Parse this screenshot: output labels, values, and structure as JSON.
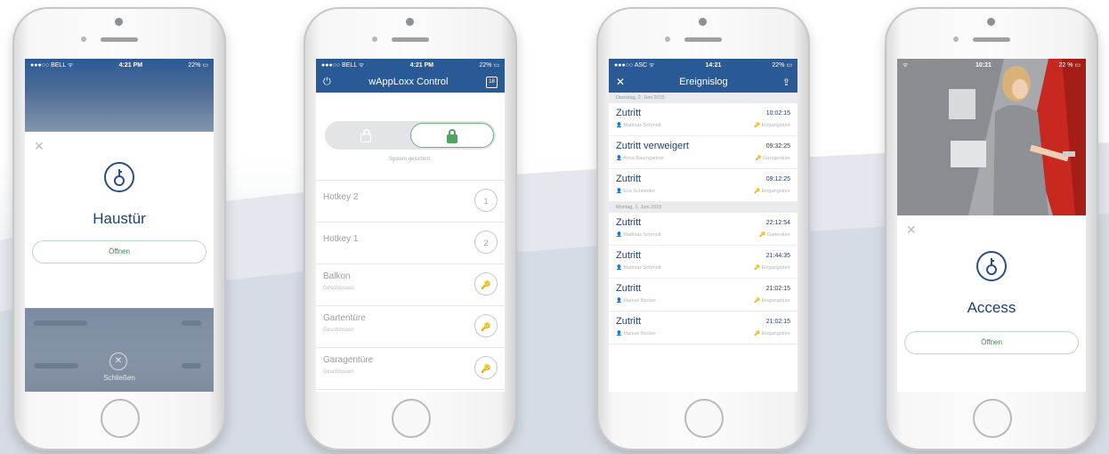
{
  "colors": {
    "brand": "#2a5a96",
    "title": "#1f3f75",
    "success": "#3c8a50",
    "success_border": "#b9dcc1"
  },
  "phone1": {
    "status": {
      "carrier": "●●●○○ BELL ᯤ",
      "time": "4:21 PM",
      "battery": "22% ▭"
    },
    "close_icon": "close-icon",
    "key_icon": "key-icon",
    "title": "Haustür",
    "open_label": "Öffnen",
    "close_label": "Schließen"
  },
  "phone2": {
    "status": {
      "carrier": "●●●○○ BELL ᯤ",
      "time": "4:21 PM",
      "battery": "22% ▭"
    },
    "nav_title": "wAppLoxx Control",
    "power_icon": "power-icon",
    "calendar_icon": "calendar-icon",
    "calendar_text": "18",
    "toggle_state": "locked",
    "system_label": "System gesichert.",
    "items": [
      {
        "name": "Hotkey 2",
        "sub": "",
        "badge": "1",
        "icon": "number"
      },
      {
        "name": "Hotkey 1",
        "sub": "",
        "badge": "2",
        "icon": "number"
      },
      {
        "name": "Balkon",
        "sub": "Geschlossen",
        "badge": "",
        "icon": "key-icon"
      },
      {
        "name": "Gartentüre",
        "sub": "Geschlossen",
        "badge": "",
        "icon": "key-icon"
      },
      {
        "name": "Garagentüre",
        "sub": "Geschlossen",
        "badge": "",
        "icon": "key-icon"
      }
    ]
  },
  "phone3": {
    "status": {
      "carrier": "●●●○○ ASC ᯤ",
      "time": "14:21",
      "battery": "22% ▭"
    },
    "nav_title": "Ereignislog",
    "sections": [
      {
        "date": "Dienstag, 2. Juni 2015",
        "events": [
          {
            "title": "Zutritt",
            "time": "10:02:15",
            "person": "Matthias Schmidt",
            "door": "Eingangstüre"
          },
          {
            "title": "Zutritt verweigert",
            "time": "09:32:25",
            "person": "Anna Baumgartner",
            "door": "Garagentüre"
          },
          {
            "title": "Zutritt",
            "time": "09:12:25",
            "person": "Eva Schneider",
            "door": "Eingangstüre"
          }
        ]
      },
      {
        "date": "Montag, 1. Juni 2015",
        "events": [
          {
            "title": "Zutritt",
            "time": "22:12:54",
            "person": "Matthias Schmidt",
            "door": "Gartentüre"
          },
          {
            "title": "Zutritt",
            "time": "21:44:35",
            "person": "Matthias Schmidt",
            "door": "Eingangstüre"
          },
          {
            "title": "Zutritt",
            "time": "21:02:15",
            "person": "Manuel Becker",
            "door": "Eingangstüre"
          },
          {
            "title": "Zutritt",
            "time": "21:02:15",
            "person": "Manuel Becker",
            "door": "Eingangstüre"
          }
        ]
      }
    ]
  },
  "phone4": {
    "status": {
      "time": "10:21",
      "battery": "22 % ▭"
    },
    "title": "Access",
    "open_label": "Öffnen"
  }
}
